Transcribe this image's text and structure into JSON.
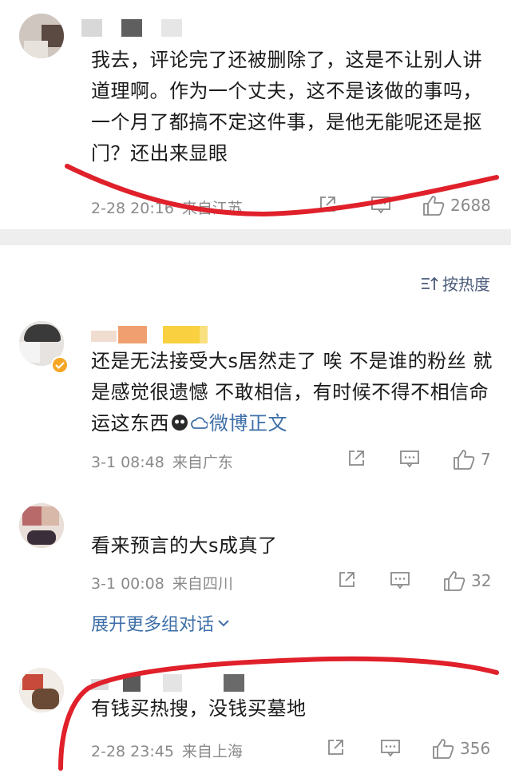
{
  "comments": [
    {
      "text": "我去，评论完了还被删除了，这是不让别人讲道理啊。作为一个丈夫，这不是该做的事吗，一个月了都搞不定这件事，是他无能呢还是抠门？还出来显眼",
      "time": "2-28 20:16",
      "location": "来自江苏",
      "likes": "2688"
    },
    {
      "text": "还是无法接受大s居然走了 唉 不是谁的粉丝 就是感觉很遗憾 不敢相信，有时候不得不相信命运这东西",
      "link": "微博正文",
      "time": "3-1 08:48",
      "location": "来自广东",
      "likes": "7"
    },
    {
      "text": "看来预言的大s成真了",
      "time": "3-1 00:08",
      "location": "来自四川",
      "likes": "32"
    },
    {
      "text": "有钱买热搜，没钱买墓地",
      "time": "2-28 23:45",
      "location": "来自上海",
      "likes": "356"
    }
  ],
  "sort_label": "按热度",
  "expand_label": "展开更多组对话",
  "colors": {
    "link": "#3e6fa8",
    "meta": "#8a8a8a",
    "annotation": "#e0202a",
    "band": "#eeeeee"
  }
}
